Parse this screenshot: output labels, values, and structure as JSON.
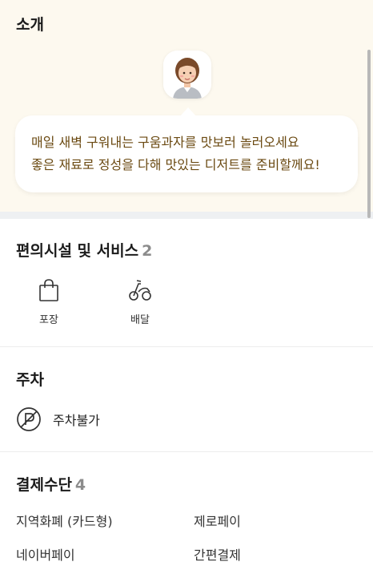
{
  "intro": {
    "title": "소개",
    "message_line1": "매일 새벽 구워내는 구움과자를 맛보러 놀러오세요",
    "message_line2": "좋은 재료로 정성을 다해 맛있는 디저트를 준비할께요!",
    "colors": {
      "background": "#fdf9ef",
      "message_text": "#6b4a12"
    }
  },
  "amenities": {
    "title": "편의시설 및 서비스",
    "count": "2",
    "items": [
      {
        "label": "포장",
        "icon": "shopping-bag-icon"
      },
      {
        "label": "배달",
        "icon": "scooter-icon"
      }
    ]
  },
  "parking": {
    "title": "주차",
    "status": "주차불가",
    "icon": "no-parking-icon"
  },
  "payment": {
    "title": "결제수단",
    "count": "4",
    "methods": [
      "지역화폐 (카드형)",
      "제로페이",
      "네이버페이",
      "간편결제"
    ]
  }
}
